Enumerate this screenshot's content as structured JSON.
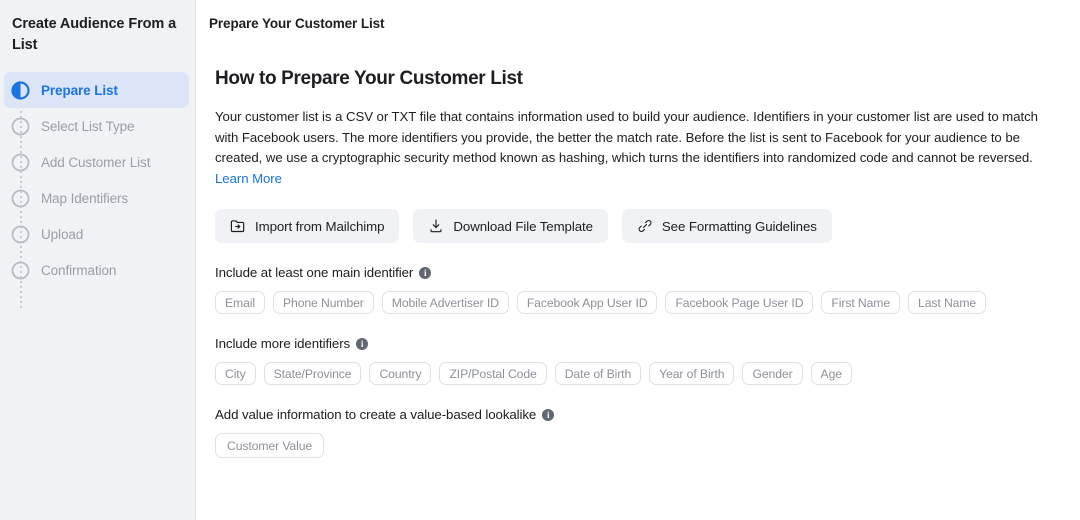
{
  "sidebar": {
    "title": "Create Audience From a List",
    "steps": [
      {
        "label": "Prepare List",
        "state": "active",
        "icon": "half-filled-circle-icon"
      },
      {
        "label": "Select List Type",
        "state": "pending",
        "icon": "empty-circle-icon"
      },
      {
        "label": "Add Customer List",
        "state": "pending",
        "icon": "empty-circle-icon"
      },
      {
        "label": "Map Identifiers",
        "state": "pending",
        "icon": "empty-circle-icon"
      },
      {
        "label": "Upload",
        "state": "pending",
        "icon": "empty-circle-icon"
      },
      {
        "label": "Confirmation",
        "state": "pending",
        "icon": "empty-circle-icon"
      }
    ]
  },
  "header": {
    "title": "Prepare Your Customer List"
  },
  "main": {
    "heading": "How to Prepare Your Customer List",
    "paragraph": "Your customer list is a CSV or TXT file that contains information used to build your audience. Identifiers in your customer list are used to match with Facebook users. The more identifiers you provide, the better the match rate. Before the list is sent to Facebook for your audience to be created, we use a cryptographic security method known as hashing, which turns the identifiers into randomized code and cannot be reversed. ",
    "learn_more": "Learn More",
    "actions": [
      {
        "label": "Import from Mailchimp",
        "icon": "folder-import-icon"
      },
      {
        "label": "Download File Template",
        "icon": "download-icon"
      },
      {
        "label": "See Formatting Guidelines",
        "icon": "link-icon"
      }
    ],
    "groups": [
      {
        "label": "Include at least one main identifier",
        "info_icon": "info-icon",
        "chips": [
          "Email",
          "Phone Number",
          "Mobile Advertiser ID",
          "Facebook App User ID",
          "Facebook Page User ID",
          "First Name",
          "Last Name"
        ]
      },
      {
        "label": "Include more identifiers",
        "info_icon": "info-icon",
        "chips": [
          "City",
          "State/Province",
          "Country",
          "ZIP/Postal Code",
          "Date of Birth",
          "Year of Birth",
          "Gender",
          "Age"
        ]
      },
      {
        "label": "Add value information to create a value-based lookalike",
        "info_icon": "info-icon",
        "chips": [
          "Customer Value"
        ]
      }
    ]
  },
  "colors": {
    "accent": "#1b74e4",
    "sidebar_bg": "#f0f2f5",
    "active_pill": "#dce5f7",
    "chip_border": "#dfe1e6",
    "text": "#1c1e21",
    "muted_text": "#8d9199"
  }
}
